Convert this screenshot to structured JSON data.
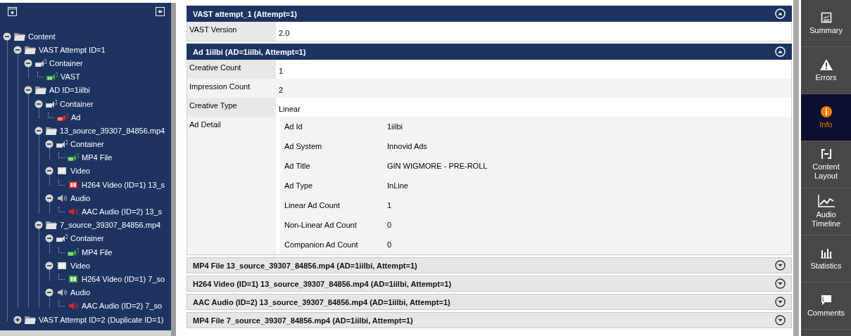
{
  "tree": [
    {
      "label": "Content",
      "kind": "folder",
      "expanded": true,
      "children": [
        {
          "label": "VAST Attempt ID=1",
          "kind": "folder",
          "expanded": true,
          "children": [
            {
              "label": "Container",
              "kind": "container",
              "expanded": true,
              "children": [
                {
                  "label": "VAST",
                  "kind": "container",
                  "color": "#3aa63a"
                }
              ]
            },
            {
              "label": "AD ID=1iilbi",
              "kind": "folder",
              "expanded": true,
              "children": [
                {
                  "label": "Container",
                  "kind": "container",
                  "expanded": true,
                  "children": [
                    {
                      "label": "Ad",
                      "kind": "container",
                      "color": "#e02424"
                    }
                  ]
                },
                {
                  "label": "13_source_39307_84856.mp4",
                  "kind": "folder",
                  "expanded": true,
                  "children": [
                    {
                      "label": "Container",
                      "kind": "container",
                      "expanded": true,
                      "children": [
                        {
                          "label": "MP4 File",
                          "kind": "container",
                          "color": "#3aa63a"
                        }
                      ]
                    },
                    {
                      "label": "Video",
                      "kind": "video",
                      "expanded": true,
                      "children": [
                        {
                          "label": "H264 Video (ID=1) 13_s",
                          "kind": "video",
                          "color": "#e02424"
                        }
                      ]
                    },
                    {
                      "label": "Audio",
                      "kind": "audio",
                      "expanded": true,
                      "children": [
                        {
                          "label": "AAC Audio (ID=2) 13_s",
                          "kind": "audio",
                          "color": "#e02424"
                        }
                      ]
                    }
                  ]
                },
                {
                  "label": "7_source_39307_84856.mp4",
                  "kind": "folder",
                  "expanded": true,
                  "children": [
                    {
                      "label": "Container",
                      "kind": "container",
                      "expanded": true,
                      "children": [
                        {
                          "label": "MP4 File",
                          "kind": "container",
                          "color": "#3aa63a"
                        }
                      ]
                    },
                    {
                      "label": "Video",
                      "kind": "video",
                      "expanded": true,
                      "children": [
                        {
                          "label": "H264 Video (ID=1) 7_so",
                          "kind": "video",
                          "color": "#3aa63a"
                        }
                      ]
                    },
                    {
                      "label": "Audio",
                      "kind": "audio",
                      "expanded": true,
                      "children": [
                        {
                          "label": "AAC Audio (ID=2) 7_so",
                          "kind": "audio",
                          "color": "#e02424"
                        }
                      ]
                    }
                  ]
                }
              ]
            }
          ]
        },
        {
          "label": "VAST Attempt ID=2 (Duplicate ID=1)",
          "kind": "folder",
          "expanded": false
        }
      ]
    }
  ],
  "sections": [
    {
      "title": "VAST attempt_1 (Attempt=1)",
      "expanded": true,
      "rows": [
        {
          "kind": "field",
          "label": "VAST Version",
          "value": "2.0"
        }
      ]
    },
    {
      "title": "Ad 1iilbi (AD=1iilbi, Attempt=1)",
      "expanded": true,
      "rows": [
        {
          "kind": "field",
          "label": "Creative Count",
          "value": "1"
        },
        {
          "kind": "field",
          "label": "Impression Count",
          "value": "2"
        },
        {
          "kind": "field",
          "label": "Creative Type",
          "value": "Linear"
        },
        {
          "kind": "group",
          "label": "Ad Detail",
          "rows": [
            {
              "kind": "field",
              "label": "Ad Id",
              "value": "1iilbi"
            },
            {
              "kind": "field",
              "label": "Ad System",
              "value": "Innovid Ads"
            },
            {
              "kind": "field",
              "label": "Ad Title",
              "value": "GIN WIGMORE - PRE-ROLL"
            },
            {
              "kind": "field",
              "label": "Ad Type",
              "value": "InLine"
            },
            {
              "kind": "field",
              "label": "Linear Ad Count",
              "value": "1"
            },
            {
              "kind": "field",
              "label": "Non-Linear Ad Count",
              "value": "0"
            },
            {
              "kind": "field",
              "label": "Companion Ad Count",
              "value": "0"
            }
          ]
        }
      ]
    },
    {
      "title": "MP4 File 13_source_39307_84856.mp4 (AD=1iilbi, Attempt=1)",
      "expanded": false
    },
    {
      "title": "H264 Video (ID=1) 13_source_39307_84856.mp4 (AD=1iilbi, Attempt=1)",
      "expanded": false
    },
    {
      "title": "AAC Audio (ID=2) 13_source_39307_84856.mp4 (AD=1iilbi, Attempt=1)",
      "expanded": false
    },
    {
      "title": "MP4 File 7_source_39307_84856.mp4 (AD=1iilbi, Attempt=1)",
      "expanded": false
    }
  ],
  "sidebar": [
    {
      "label": "Summary",
      "kind": "summary",
      "selected": false
    },
    {
      "label": "Errors",
      "kind": "errors",
      "selected": false
    },
    {
      "label": "Info",
      "kind": "info",
      "selected": true
    },
    {
      "label": "Content Layout",
      "kind": "layout",
      "selected": false
    },
    {
      "label": "Audio Timeline",
      "kind": "timeline",
      "selected": false
    },
    {
      "label": "Statistics",
      "kind": "statistics",
      "selected": false
    },
    {
      "label": "Comments",
      "kind": "comments",
      "selected": false
    }
  ]
}
